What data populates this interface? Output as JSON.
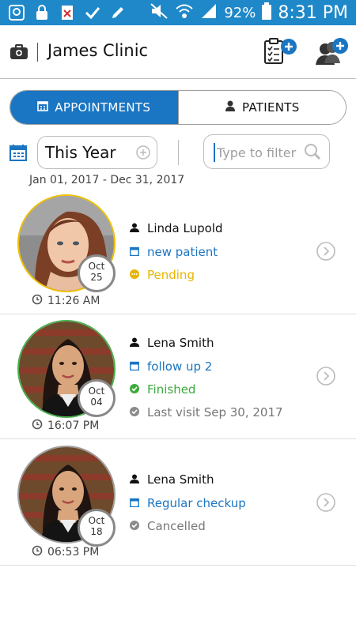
{
  "status_bar": {
    "battery": "92%",
    "time": "8:31 PM",
    "icons": [
      "app-icon",
      "lock-icon",
      "close-file-icon",
      "check-icon",
      "pen-icon",
      "mute-icon",
      "wifi-icon",
      "signal-icon",
      "battery-icon"
    ]
  },
  "header": {
    "title": "James Clinic",
    "icons": [
      "clinic-icon",
      "add-appointment-icon",
      "add-patient-icon"
    ]
  },
  "tabs": [
    {
      "label": "APPOINTMENTS",
      "active": true
    },
    {
      "label": "PATIENTS",
      "active": false
    }
  ],
  "filter": {
    "period": "This Year",
    "placeholder": "Type to filter",
    "date_range": "Jan 01, 2017 - Dec 31, 2017"
  },
  "appointments": [
    {
      "name": "Linda Lupold",
      "type": "new patient",
      "status": "Pending",
      "month": "Oct",
      "day": "25",
      "time": "11:26 AM",
      "last_visit": ""
    },
    {
      "name": "Lena Smith",
      "type": "follow up 2",
      "status": "Finished",
      "month": "Oct",
      "day": "04",
      "time": "16:07 PM",
      "last_visit": "Last visit Sep 30, 2017"
    },
    {
      "name": "Lena Smith",
      "type": "Regular checkup",
      "status": "Cancelled",
      "month": "Oct",
      "day": "18",
      "time": "06:53 PM",
      "last_visit": ""
    }
  ],
  "colors": {
    "status_bar": "#1e88c9",
    "accent": "#1a75c2",
    "pending": "#e7b500",
    "finished": "#3daa3d",
    "cancelled": "#777777"
  }
}
